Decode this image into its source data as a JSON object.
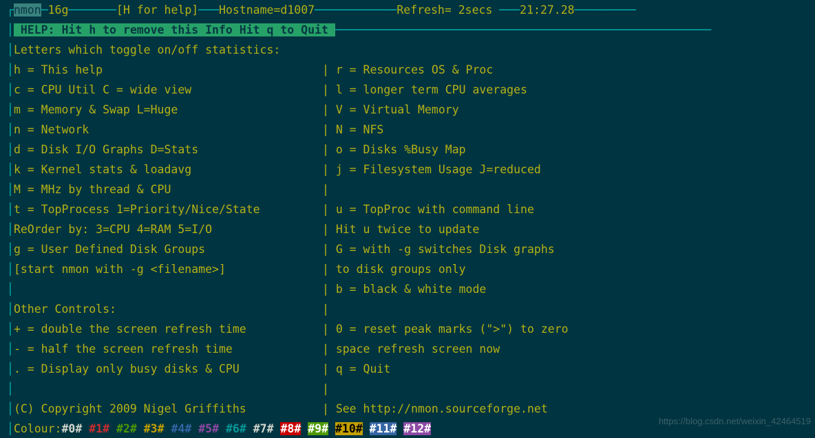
{
  "header": {
    "prog": "nmon",
    "version": "16g",
    "hint": "[H for help]",
    "host_label": "Hostname=",
    "hostname": "d1007",
    "refresh_label": "Refresh= ",
    "refresh": "2secs",
    "clock": "21:27.28"
  },
  "help_bar": {
    "left": "HELP: Hit h to remove this Info",
    "right": "Hit q to Quit"
  },
  "section_title": "Letters which toggle on/off statistics:",
  "left_col": [
    "h = This help",
    "c = CPU Util   C = wide view",
    "m = Memory & Swap    L=Huge",
    "n = Network",
    "d = Disk I/O Graphs  D=Stats",
    "k = Kernel stats & loadavg",
    "M = MHz by thread & CPU",
    "t = TopProcess 1=Priority/Nice/State",
    "    ReOrder by: 3=CPU 4=RAM 5=I/O",
    "g = User Defined Disk Groups",
    "    [start nmon with -g <filename>]",
    "",
    "Other Controls:",
    "+ = double the screen refresh time",
    "- = half   the screen refresh time",
    ". = Display only busy disks & CPU",
    "",
    "(C) Copyright 2009 Nigel Griffiths"
  ],
  "right_col": [
    "r = Resources OS & Proc",
    "l = longer term CPU averages",
    "V = Virtual Memory",
    "N = NFS",
    "o = Disks %Busy Map",
    "j = Filesystem Usage J=reduced",
    "",
    "u = TopProc with command line",
    "    Hit u twice to update",
    "G = with -g switches Disk graphs",
    "    to disk groups only",
    "b = black & white mode",
    "",
    "0 = reset peak marks (\">\") to zero",
    "space refresh screen now",
    "q = Quit",
    "",
    "See http://nmon.sourceforge.net"
  ],
  "colour_label": "Colour:",
  "colours": [
    {
      "t": "#0#",
      "cls": "fg-white"
    },
    {
      "t": "#1#",
      "cls": "fg-red"
    },
    {
      "t": "#2#",
      "cls": "fg-green"
    },
    {
      "t": "#3#",
      "cls": "fg-yel"
    },
    {
      "t": "#4#",
      "cls": "fg-blue"
    },
    {
      "t": "#5#",
      "cls": "fg-mag"
    },
    {
      "t": "#6#",
      "cls": "fg-cyan"
    },
    {
      "t": "#7#",
      "cls": "fg-white"
    },
    {
      "t": "#8#",
      "cls": "bg-red"
    },
    {
      "t": "#9#",
      "cls": "bg-green"
    },
    {
      "t": "#10#",
      "cls": "bg-yel"
    },
    {
      "t": "#11#",
      "cls": "bg-blue"
    },
    {
      "t": "#12#",
      "cls": "bg-mag"
    }
  ],
  "watermark": "https://blog.csdn.net/weixin_42464519"
}
